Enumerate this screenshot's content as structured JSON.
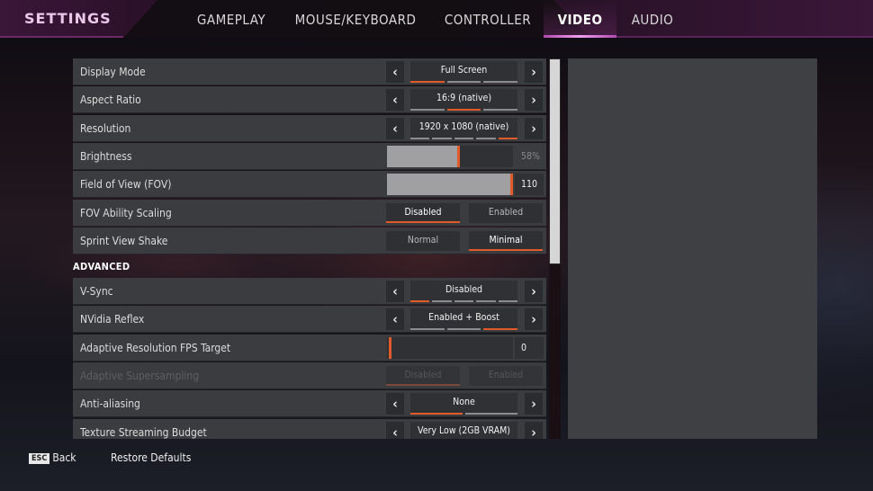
{
  "header": {
    "title": "SETTINGS",
    "tabs": [
      {
        "label": "GAMEPLAY",
        "active": false
      },
      {
        "label": "MOUSE/KEYBOARD",
        "active": false
      },
      {
        "label": "CONTROLLER",
        "active": false
      },
      {
        "label": "VIDEO",
        "active": true
      },
      {
        "label": "AUDIO",
        "active": false
      }
    ]
  },
  "colors": {
    "accent": "#e05a2a",
    "tab_underline": "#d070d0",
    "row_bg": "#3b3c3f",
    "panel_bg": "#3f4044"
  },
  "settings": [
    {
      "label": "Display Mode",
      "type": "carousel",
      "value": "Full Screen",
      "options_count": 3,
      "selected_index": 0
    },
    {
      "label": "Aspect Ratio",
      "type": "carousel",
      "value": "16:9 (native)",
      "options_count": 3,
      "selected_index": 1
    },
    {
      "label": "Resolution",
      "type": "carousel",
      "value": "1920 x 1080 (native)",
      "options_count": 5,
      "selected_index": 4
    },
    {
      "label": "Brightness",
      "type": "slider",
      "value_text": "58%",
      "fraction": 0.58
    },
    {
      "label": "Field of View (FOV)",
      "type": "slider",
      "value_text": "110",
      "fraction": 1.0
    },
    {
      "label": "FOV Ability Scaling",
      "type": "toggle",
      "options": [
        "Disabled",
        "Enabled"
      ],
      "selected_index": 0
    },
    {
      "label": "Sprint View Shake",
      "type": "toggle",
      "options": [
        "Normal",
        "Minimal"
      ],
      "selected_index": 1
    }
  ],
  "advanced": {
    "heading": "ADVANCED",
    "settings": [
      {
        "label": "V-Sync",
        "type": "carousel",
        "value": "Disabled",
        "options_count": 5,
        "selected_index": 0
      },
      {
        "label": "NVidia Reflex",
        "type": "carousel",
        "value": "Enabled + Boost",
        "options_count": 3,
        "selected_index": 2
      },
      {
        "label": "Adaptive Resolution FPS Target",
        "type": "slider",
        "value_text": "0",
        "fraction": 0.0
      },
      {
        "label": "Adaptive Supersampling",
        "type": "toggle",
        "options": [
          "Disabled",
          "Enabled"
        ],
        "selected_index": 0,
        "disabled": true
      },
      {
        "label": "Anti-aliasing",
        "type": "carousel",
        "value": "None",
        "options_count": 2,
        "selected_index": 0
      },
      {
        "label": "Texture Streaming Budget",
        "type": "carousel",
        "value": "Very Low (2GB VRAM)",
        "options_count": 0,
        "selected_index": 0
      }
    ]
  },
  "scrollbar": {
    "position_fraction": 0.0,
    "visible_fraction": 0.54
  },
  "footer": {
    "back_key": "ESC",
    "back_label": "Back",
    "restore_label": "Restore Defaults"
  }
}
